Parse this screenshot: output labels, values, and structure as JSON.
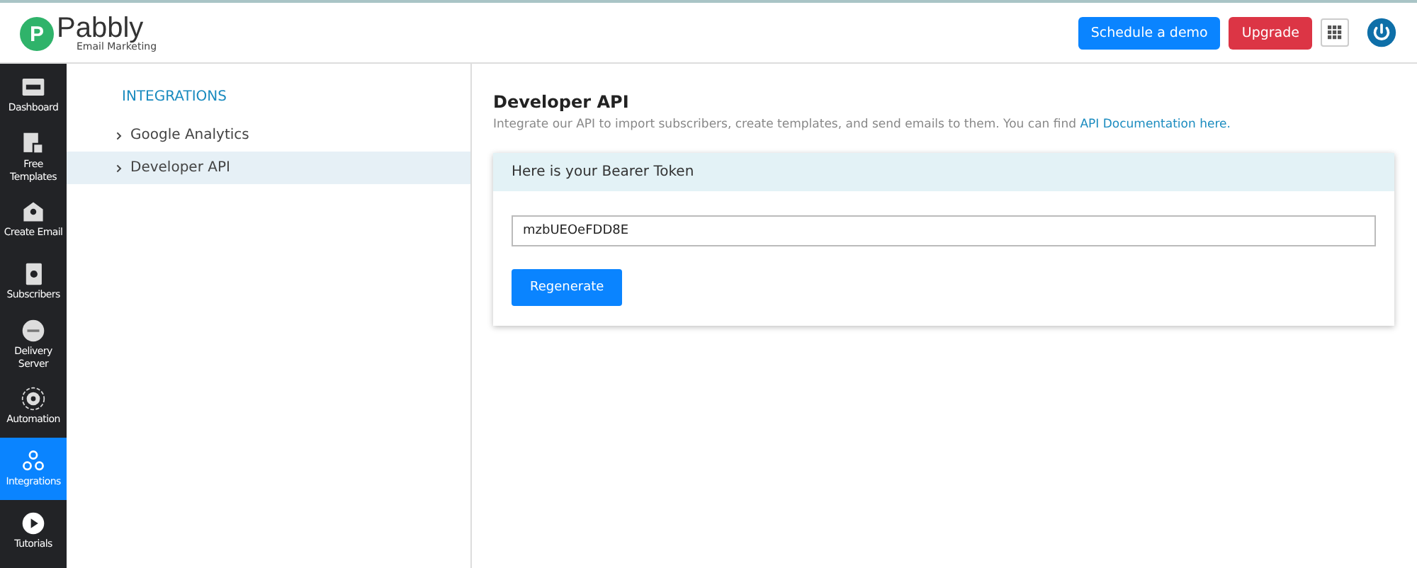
{
  "header": {
    "logo": {
      "letter": "P",
      "name": "Pabbly",
      "tagline": "Email Marketing"
    },
    "buttons": [
      {
        "label": "Schedule a demo",
        "kind": "primary"
      },
      {
        "label": "Upgrade",
        "kind": "danger"
      }
    ]
  },
  "sidebar": {
    "items": [
      {
        "label": "Dashboard",
        "kind": "dashboard",
        "selected": false
      },
      {
        "label": "Free Templates",
        "kind": "templates",
        "selected": false
      },
      {
        "label": "Create Email",
        "kind": "email",
        "selected": false
      },
      {
        "label": "Subscribers",
        "kind": "subscribers",
        "selected": false
      },
      {
        "label": "Delivery Server",
        "kind": "smtp",
        "selected": false
      },
      {
        "label": "Automation",
        "kind": "automation",
        "selected": false
      },
      {
        "label": "Integrations",
        "kind": "integrations",
        "selected": true
      },
      {
        "label": "Tutorials",
        "kind": "tutorials",
        "selected": false
      }
    ]
  },
  "subnav": {
    "title": "INTEGRATIONS",
    "items": [
      {
        "label": "Google Analytics",
        "selected": false
      },
      {
        "label": "Developer API",
        "selected": true
      }
    ]
  },
  "content": {
    "title": "Developer API",
    "description": "Integrate our API to import subscribers, create templates, and send emails to them. You can find ",
    "link": "API Documentation here.",
    "card": {
      "title": "Here is your Bearer Token",
      "token": "mzbUEOeFDD8E",
      "button": "Regenerate"
    }
  }
}
